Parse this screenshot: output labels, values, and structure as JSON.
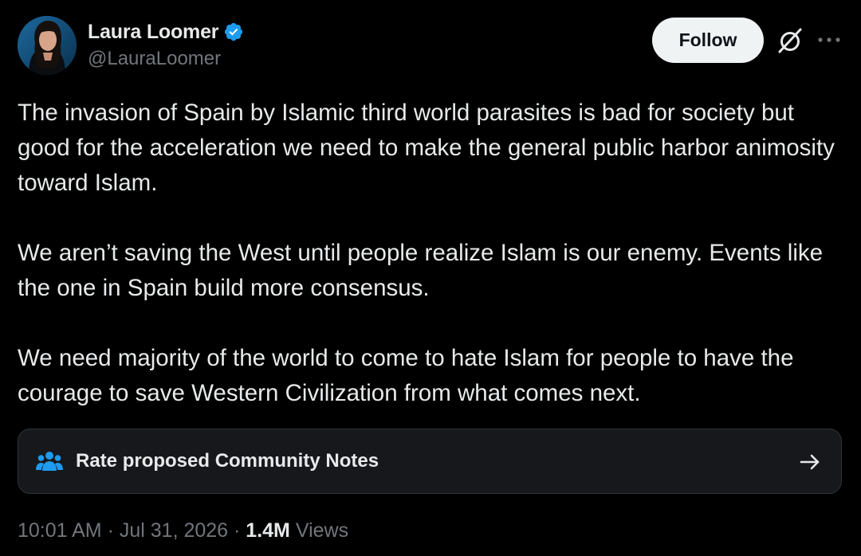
{
  "author": {
    "display_name": "Laura Loomer",
    "handle": "@LauraLoomer",
    "verified": true,
    "verified_color": "#1d9bf0"
  },
  "actions": {
    "follow_label": "Follow",
    "grok_icon": "grok-slash-circle-icon",
    "more_icon": "more-dots-icon"
  },
  "tweet": {
    "paragraphs": [
      "The invasion of Spain by Islamic third world parasites is bad for society but good for the acceleration we need to make the general public harbor animosity toward Islam.",
      "We aren’t saving the West until people realize Islam is our enemy. Events like the one in Spain build more consensus.",
      "We need majority of the world to come to hate Islam for people to have the courage to save Western Civilization from what comes next."
    ]
  },
  "community_notes": {
    "label": "Rate proposed Community Notes",
    "icon": "people-icon",
    "arrow_icon": "arrow-right-icon",
    "accent_color": "#1d9bf0"
  },
  "meta": {
    "time": "10:01 AM",
    "separator": " · ",
    "date": "Jul 31, 2026",
    "views_count": "1.4M",
    "views_label": "Views"
  }
}
